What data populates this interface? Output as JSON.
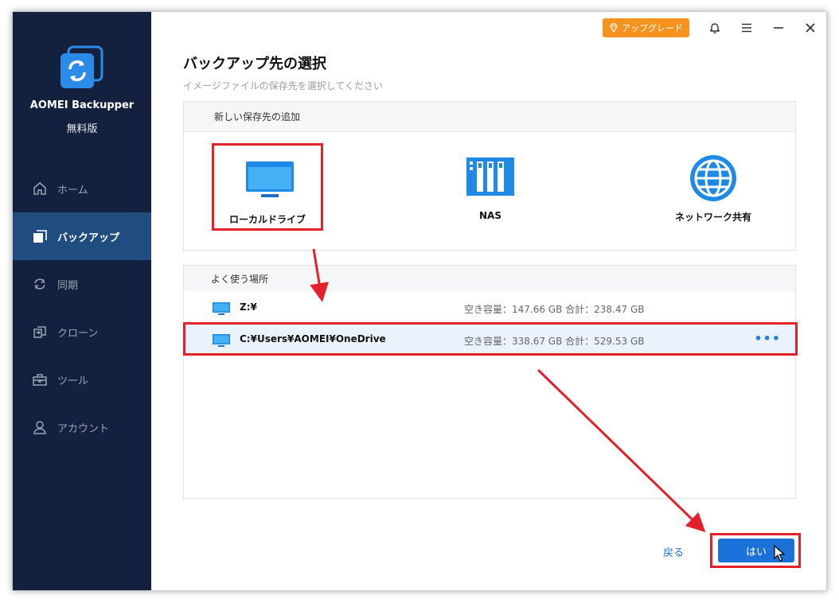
{
  "app": {
    "name": "AOMEI Backupper",
    "edition": "無料版"
  },
  "sidebar": {
    "items": [
      {
        "label": "ホーム",
        "icon": "home-icon",
        "active": false
      },
      {
        "label": "バックアップ",
        "icon": "backup-icon",
        "active": true
      },
      {
        "label": "同期",
        "icon": "sync-icon",
        "active": false
      },
      {
        "label": "クローン",
        "icon": "clone-icon",
        "active": false
      },
      {
        "label": "ツール",
        "icon": "tools-icon",
        "active": false
      },
      {
        "label": "アカウント",
        "icon": "account-icon",
        "active": false
      }
    ]
  },
  "topbar": {
    "upgrade_label": "アップグレード"
  },
  "page": {
    "title": "バックアップ先の選択",
    "subtitle": "イメージファイルの保存先を選択してください"
  },
  "new_destination": {
    "header": "新しい保存先の追加",
    "options": [
      {
        "label": "ローカルドライブ",
        "icon": "monitor-icon",
        "selected": true
      },
      {
        "label": "NAS",
        "icon": "nas-icon",
        "selected": false
      },
      {
        "label": "ネットワーク共有",
        "icon": "globe-icon",
        "selected": false
      }
    ]
  },
  "frequent": {
    "header": "よく使う場所",
    "rows": [
      {
        "path": "Z:¥",
        "info": "空き容量：147.66 GB 合計：238.47 GB"
      },
      {
        "path": "C:¥Users¥AOMEI¥OneDrive",
        "info": "空き容量：338.67 GB 合計：529.53 GB",
        "more": "•••"
      }
    ]
  },
  "footer": {
    "back_label": "戻る",
    "yes_label": "はい"
  },
  "colors": {
    "sidebar": "#13213f",
    "active": "#1f4d80",
    "accent": "#1a72d9",
    "upgrade": "#f6921e",
    "highlight": "#e3212a"
  }
}
